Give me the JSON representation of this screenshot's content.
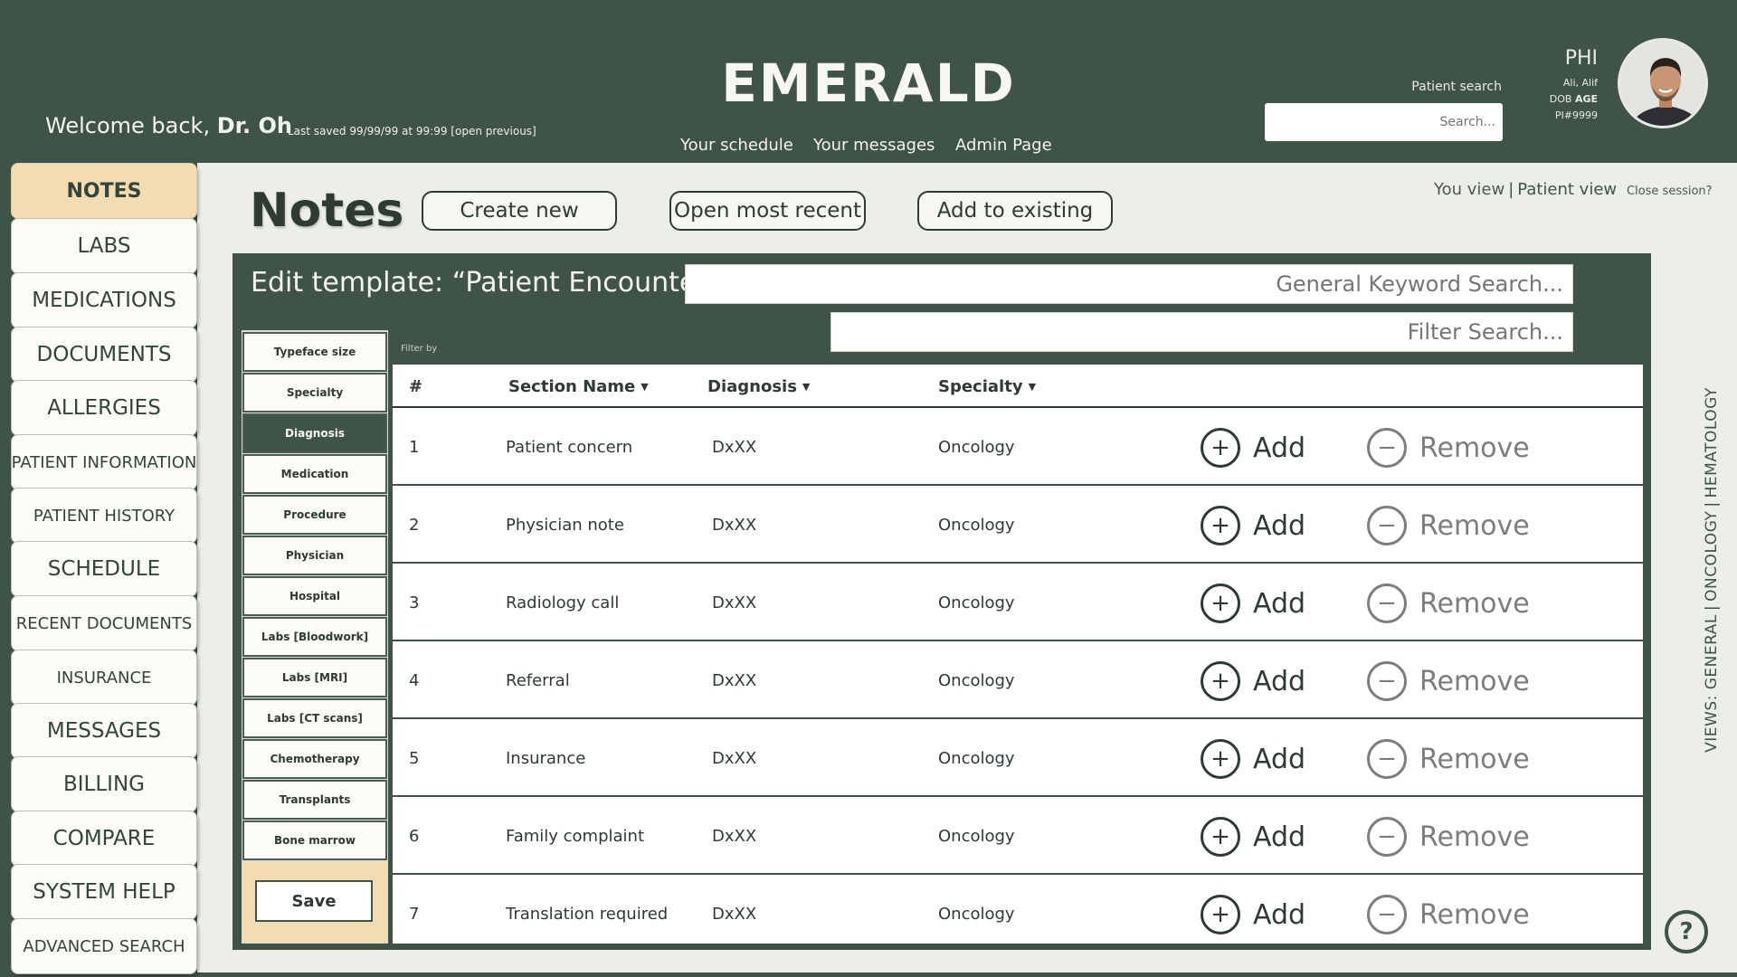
{
  "header": {
    "welcome_prefix": "Welcome back,",
    "welcome_name": "Dr. Oh",
    "last_saved": "Last saved 99/99/99 at 99:99  [open previous]",
    "brand": "EMERALD",
    "nav": [
      "Your schedule",
      "Your messages",
      "Admin Page"
    ],
    "patient_search_label": "Patient search",
    "patient_search_placeholder": "Search...",
    "phi": {
      "title": "PHI",
      "name": "Ali, Alif",
      "dob_label": "DOB",
      "age_label": "AGE",
      "id": "PI#9999"
    }
  },
  "sidebar": {
    "items": [
      {
        "label": "NOTES",
        "active": true
      },
      {
        "label": "LABS"
      },
      {
        "label": "MEDICATIONS"
      },
      {
        "label": "DOCUMENTS"
      },
      {
        "label": "ALLERGIES"
      },
      {
        "label": "PATIENT INFORMATION"
      },
      {
        "label": "PATIENT HISTORY"
      },
      {
        "label": "SCHEDULE"
      },
      {
        "label": "RECENT DOCUMENTS"
      },
      {
        "label": "INSURANCE"
      },
      {
        "label": "MESSAGES"
      },
      {
        "label": "BILLING"
      },
      {
        "label": "COMPARE"
      },
      {
        "label": "SYSTEM HELP"
      },
      {
        "label": "ADVANCED SEARCH"
      }
    ]
  },
  "page": {
    "title": "Notes",
    "actions": [
      "Create new",
      "Open most recent",
      "Add to existing"
    ],
    "view_you": "You view",
    "view_separator": "|",
    "view_patient": "Patient view",
    "close_session": "Close session?"
  },
  "template": {
    "title": "Edit template: “Patient Encounter”",
    "keyword_placeholder": "General Keyword Search...",
    "filter_placeholder": "Filter Search...",
    "filter_by_label": "Filter by",
    "filters": [
      "Typeface size",
      "Specialty",
      "Diagnosis",
      "Medication",
      "Procedure",
      "Physician",
      "Hospital",
      "Labs [Bloodwork]",
      "Labs [MRI]",
      "Labs [CT scans]",
      "Chemotherapy",
      "Transplants",
      "Bone marrow"
    ],
    "active_filter": "Diagnosis",
    "save_label": "Save"
  },
  "table": {
    "columns": [
      "#",
      "Section Name",
      "Diagnosis",
      "Specialty"
    ],
    "add_label": "Add",
    "remove_label": "Remove",
    "rows": [
      {
        "num": "1",
        "section": "Patient concern",
        "diagnosis": "DxXX",
        "specialty": "Oncology"
      },
      {
        "num": "2",
        "section": "Physician note",
        "diagnosis": "DxXX",
        "specialty": "Oncology"
      },
      {
        "num": "3",
        "section": "Radiology call",
        "diagnosis": "DxXX",
        "specialty": "Oncology"
      },
      {
        "num": "4",
        "section": "Referral",
        "diagnosis": "DxXX",
        "specialty": "Oncology"
      },
      {
        "num": "5",
        "section": "Insurance",
        "diagnosis": "DxXX",
        "specialty": "Oncology"
      },
      {
        "num": "6",
        "section": "Family complaint",
        "diagnosis": "DxXX",
        "specialty": "Oncology"
      },
      {
        "num": "7",
        "section": "Translation required",
        "diagnosis": "DxXX",
        "specialty": "Oncology"
      }
    ]
  },
  "views": {
    "prefix": "VIEWS:",
    "items": [
      "GENERAL",
      "ONCOLOGY",
      "HEMATOLOGY"
    ]
  },
  "icons": {
    "add": "plus-circle-icon",
    "remove": "minus-circle-icon",
    "help": "help-question-icon",
    "sort": "caret-down-icon"
  },
  "colors": {
    "brand_green": "#3f5346",
    "active_tan": "#f3dcb1",
    "panel_bg": "#ebeee9"
  }
}
